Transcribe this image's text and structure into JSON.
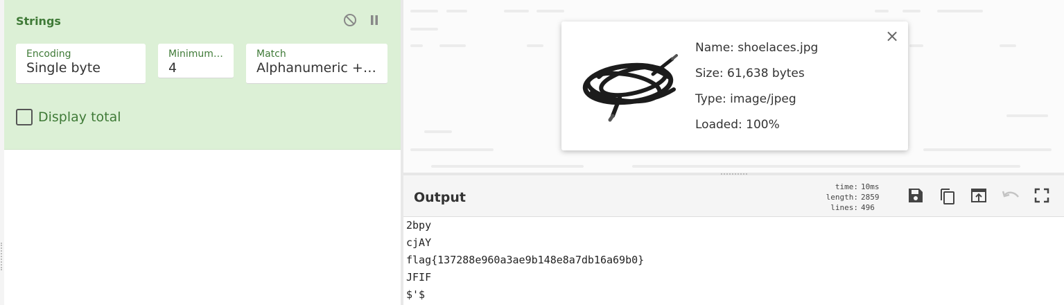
{
  "operation": {
    "title": "Strings",
    "encoding": {
      "label": "Encoding",
      "value": "Single byte"
    },
    "min_length": {
      "label": "Minimum length",
      "value": "4"
    },
    "match": {
      "label": "Match",
      "value": "Alphanumeric + punctuation (A)"
    },
    "display_total": {
      "label": "Display total",
      "checked": false
    }
  },
  "file_info": {
    "name_line": "Name: shoelaces.jpg",
    "size_line": "Size: 61,638 bytes",
    "type_line": "Type: image/jpeg",
    "loaded_line": "Loaded: 100%",
    "close_symbol": "×"
  },
  "output": {
    "title": "Output",
    "stats": {
      "time_label": "time:",
      "time_value": "10ms",
      "length_label": "length:",
      "length_value": "2859",
      "lines_label": "lines:",
      "lines_value": "496"
    },
    "lines": [
      "2bpy",
      "cjAY",
      "flag{137288e960a3ae9b148e8a7db16a69b0}",
      "JFIF",
      "$'$"
    ]
  },
  "colors": {
    "operation_bg": "#dcf0d6",
    "operation_accent": "#3f7a37",
    "icon_gray": "#555555"
  },
  "icons": {
    "disable": "disable-icon",
    "pause": "pause-icon",
    "save": "save-icon",
    "copy": "copy-icon",
    "replace_input": "open-in-input-icon",
    "undo": "undo-icon",
    "maximise": "fullscreen-icon"
  }
}
